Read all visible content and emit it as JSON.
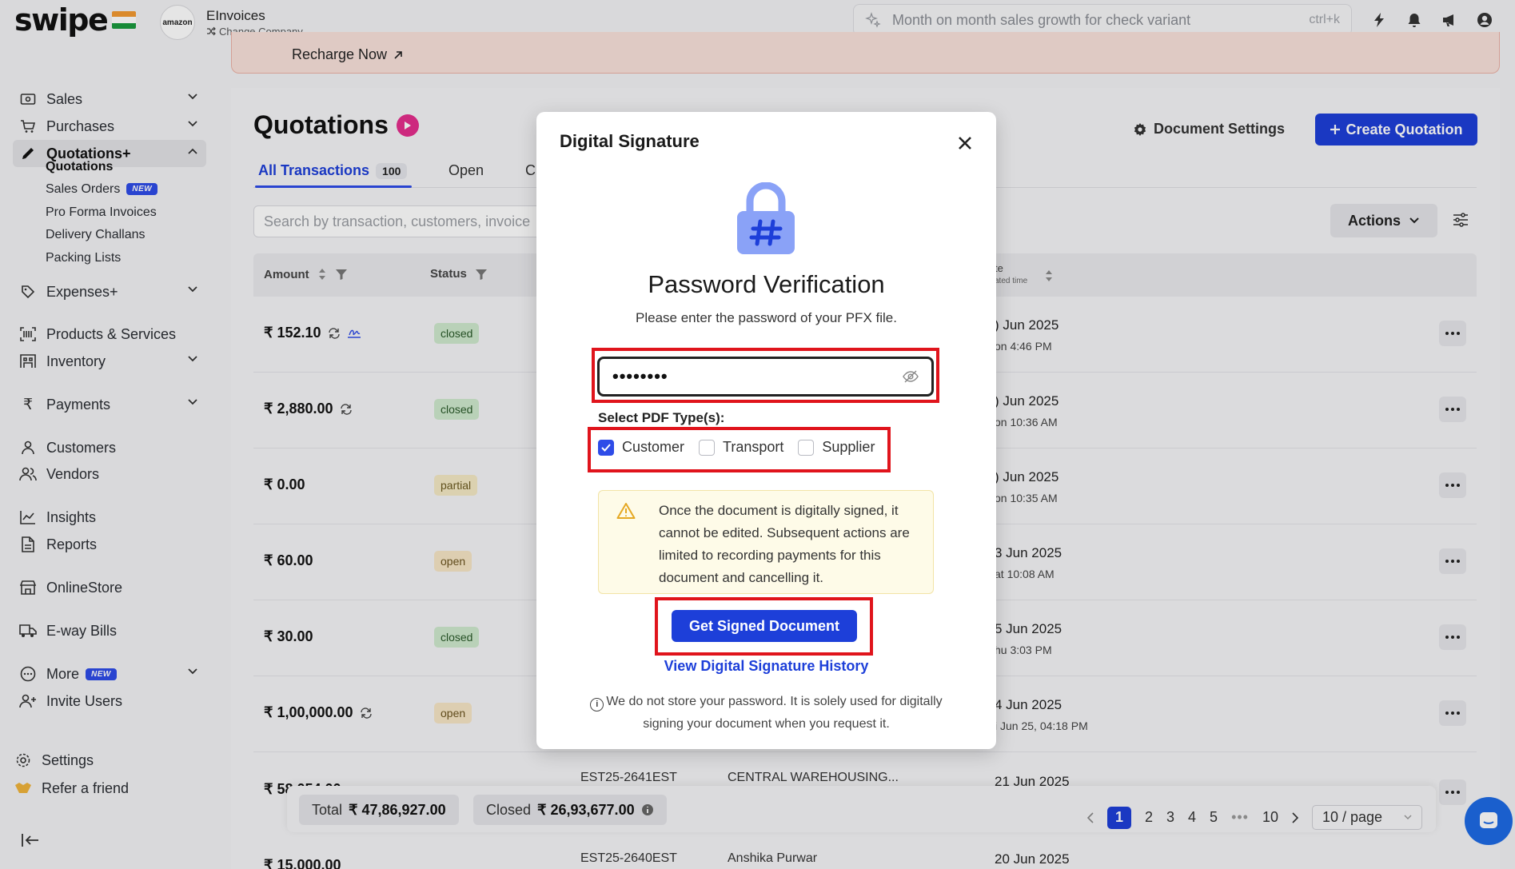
{
  "topbar": {
    "logo": "swipe",
    "company_badge": "amazon",
    "company_name": "EInvoices",
    "change_company": "Change Company",
    "search_placeholder": "Month on month sales growth for check variant",
    "search_shortcut": "ctrl+k"
  },
  "sidebar": {
    "sales": "Sales",
    "purchases": "Purchases",
    "quotations": "Quotations+",
    "sub": {
      "quotations": "Quotations",
      "sales_orders": "Sales Orders",
      "pro_forma": "Pro Forma Invoices",
      "delivery_challans": "Delivery Challans",
      "packing_lists": "Packing Lists"
    },
    "new_badge": "NEW",
    "expenses": "Expenses+",
    "products": "Products & Services",
    "inventory": "Inventory",
    "payments": "Payments",
    "customers": "Customers",
    "vendors": "Vendors",
    "insights": "Insights",
    "reports": "Reports",
    "online_store": "OnlineStore",
    "eway": "E-way Bills",
    "more": "More",
    "invite": "Invite Users",
    "settings": "Settings",
    "refer": "Refer a friend"
  },
  "banner": {
    "recharge": "Recharge Now"
  },
  "page": {
    "title": "Quotations",
    "tab_all": "All Transactions",
    "tab_all_count": "100",
    "tab_open": "Open",
    "tab_c": "C",
    "document_settings": "Document Settings",
    "create_button": "Create Quotation",
    "search_placeholder": "Search by transaction, customers, invoice",
    "actions": "Actions"
  },
  "table": {
    "headers": {
      "amount": "Amount",
      "status": "Status",
      "date": "te",
      "date_sub": "ated time"
    },
    "rows": [
      {
        "amount": "₹ 152.10",
        "status": "closed",
        "date": ") Jun 2025",
        "sub": "on 4:46 PM"
      },
      {
        "amount": "₹ 2,880.00",
        "status": "closed",
        "date": ") Jun 2025",
        "sub": "on 10:36 AM"
      },
      {
        "amount": "₹ 0.00",
        "status": "partial",
        "date": ") Jun 2025",
        "sub": "on 10:35 AM"
      },
      {
        "amount": "₹ 60.00",
        "status": "open",
        "date": "3 Jun 2025",
        "sub": "at 10:08 AM"
      },
      {
        "amount": "₹ 30.00",
        "status": "closed",
        "date": "5 Jun 2025",
        "sub": "hu 3:03 PM"
      },
      {
        "amount": "₹ 1,00,000.00",
        "status": "open",
        "date": "4 Jun 2025",
        "sub": "i Jun 25, 04:18 PM"
      },
      {
        "amount": "₹ 58,054.00",
        "est": "EST25-2641EST",
        "customer": "CENTRAL WAREHOUSING...",
        "date": "21 Jun 2025"
      },
      {
        "amount": "₹ 15,000.00",
        "est": "EST25-2640EST",
        "customer": "Anshika Purwar",
        "date": "20 Jun 2025"
      }
    ]
  },
  "totals": {
    "total_label": "Total",
    "total_value": "₹ 47,86,927.00",
    "closed_label": "Closed",
    "closed_value": "₹ 26,93,677.00"
  },
  "pagination": {
    "pages": [
      "1",
      "2",
      "3",
      "4",
      "5"
    ],
    "ellipsis": "•••",
    "last": "10",
    "per_page": "10 / page"
  },
  "modal": {
    "title": "Digital Signature",
    "heading": "Password Verification",
    "subtitle": "Please enter the password of your PFX file.",
    "password_value": "••••••••",
    "pdf_type_label": "Select PDF Type(s):",
    "options": [
      {
        "label": "Customer",
        "checked": true
      },
      {
        "label": "Transport",
        "checked": false
      },
      {
        "label": "Supplier",
        "checked": false
      }
    ],
    "warning": "Once the document is digitally signed, it cannot be edited. Subsequent actions are limited to recording payments for this document and cancelling it.",
    "primary_button": "Get Signed Document",
    "history_link": "View Digital Signature History",
    "footer_note": "We do not store your password. It is solely used for digitally signing your document when you request it."
  },
  "colors": {
    "primary": "#1d3fd9",
    "highlight_red": "#e0141c",
    "closed_bg": "#cfe9cd",
    "open_bg": "#f7e6c6"
  }
}
